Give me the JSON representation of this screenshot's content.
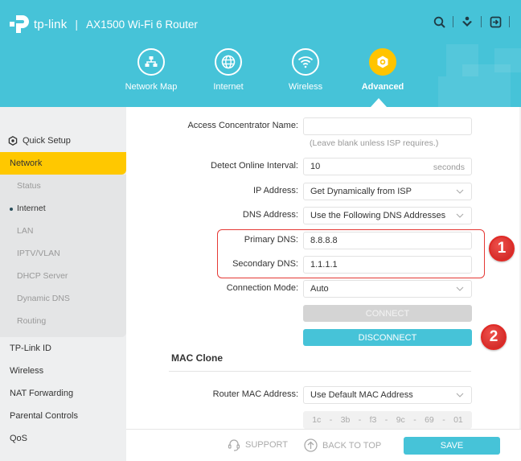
{
  "header": {
    "brand": "tp-link",
    "separator": "|",
    "model": "AX1500 Wi-Fi 6 Router",
    "top_icons": [
      "search-icon",
      "download-icon",
      "logout-icon"
    ],
    "nav": [
      {
        "label": "Network Map",
        "icon": "network-map-icon"
      },
      {
        "label": "Internet",
        "icon": "globe-icon"
      },
      {
        "label": "Wireless",
        "icon": "wifi-icon"
      },
      {
        "label": "Advanced",
        "icon": "gear-icon",
        "active": true
      }
    ]
  },
  "sidebar": {
    "quick_setup": "Quick Setup",
    "active_section": "Network",
    "sub_items": [
      "Status",
      "Internet",
      "LAN",
      "IPTV/VLAN",
      "DHCP Server",
      "Dynamic DNS",
      "Routing"
    ],
    "current_sub": "Internet",
    "items": [
      "TP-Link ID",
      "Wireless",
      "NAT Forwarding",
      "Parental Controls",
      "QoS"
    ]
  },
  "form": {
    "access_concentrator": {
      "label": "Access Concentrator Name:",
      "value": "",
      "hint": "(Leave blank unless ISP requires.)"
    },
    "detect_interval": {
      "label": "Detect Online Interval:",
      "value": "10",
      "suffix": "seconds"
    },
    "ip_address": {
      "label": "IP Address:",
      "value": "Get Dynamically from ISP"
    },
    "dns_address": {
      "label": "DNS Address:",
      "value": "Use the Following DNS Addresses"
    },
    "primary_dns": {
      "label": "Primary DNS:",
      "value": "8.8.8.8"
    },
    "secondary_dns": {
      "label": "Secondary DNS:",
      "value": "1.1.1.1"
    },
    "connection_mode": {
      "label": "Connection Mode:",
      "value": "Auto"
    },
    "connect_label": "CONNECT",
    "disconnect_label": "DISCONNECT"
  },
  "mac_clone": {
    "title": "MAC Clone",
    "router_mac": {
      "label": "Router MAC Address:",
      "value": "Use Default MAC Address"
    },
    "mac_parts": [
      "1c",
      "3b",
      "f3",
      "9c",
      "69",
      "01"
    ],
    "mac_sep": "-"
  },
  "annotations": {
    "badge_1": "1",
    "badge_2": "2"
  },
  "footer": {
    "support": "SUPPORT",
    "back_to_top": "BACK TO TOP",
    "save": "SAVE"
  },
  "colors": {
    "header": "#46c3d8",
    "accent_yellow": "#ffc800",
    "primary_button": "#46c3d8",
    "annotation_red": "#e53935"
  }
}
